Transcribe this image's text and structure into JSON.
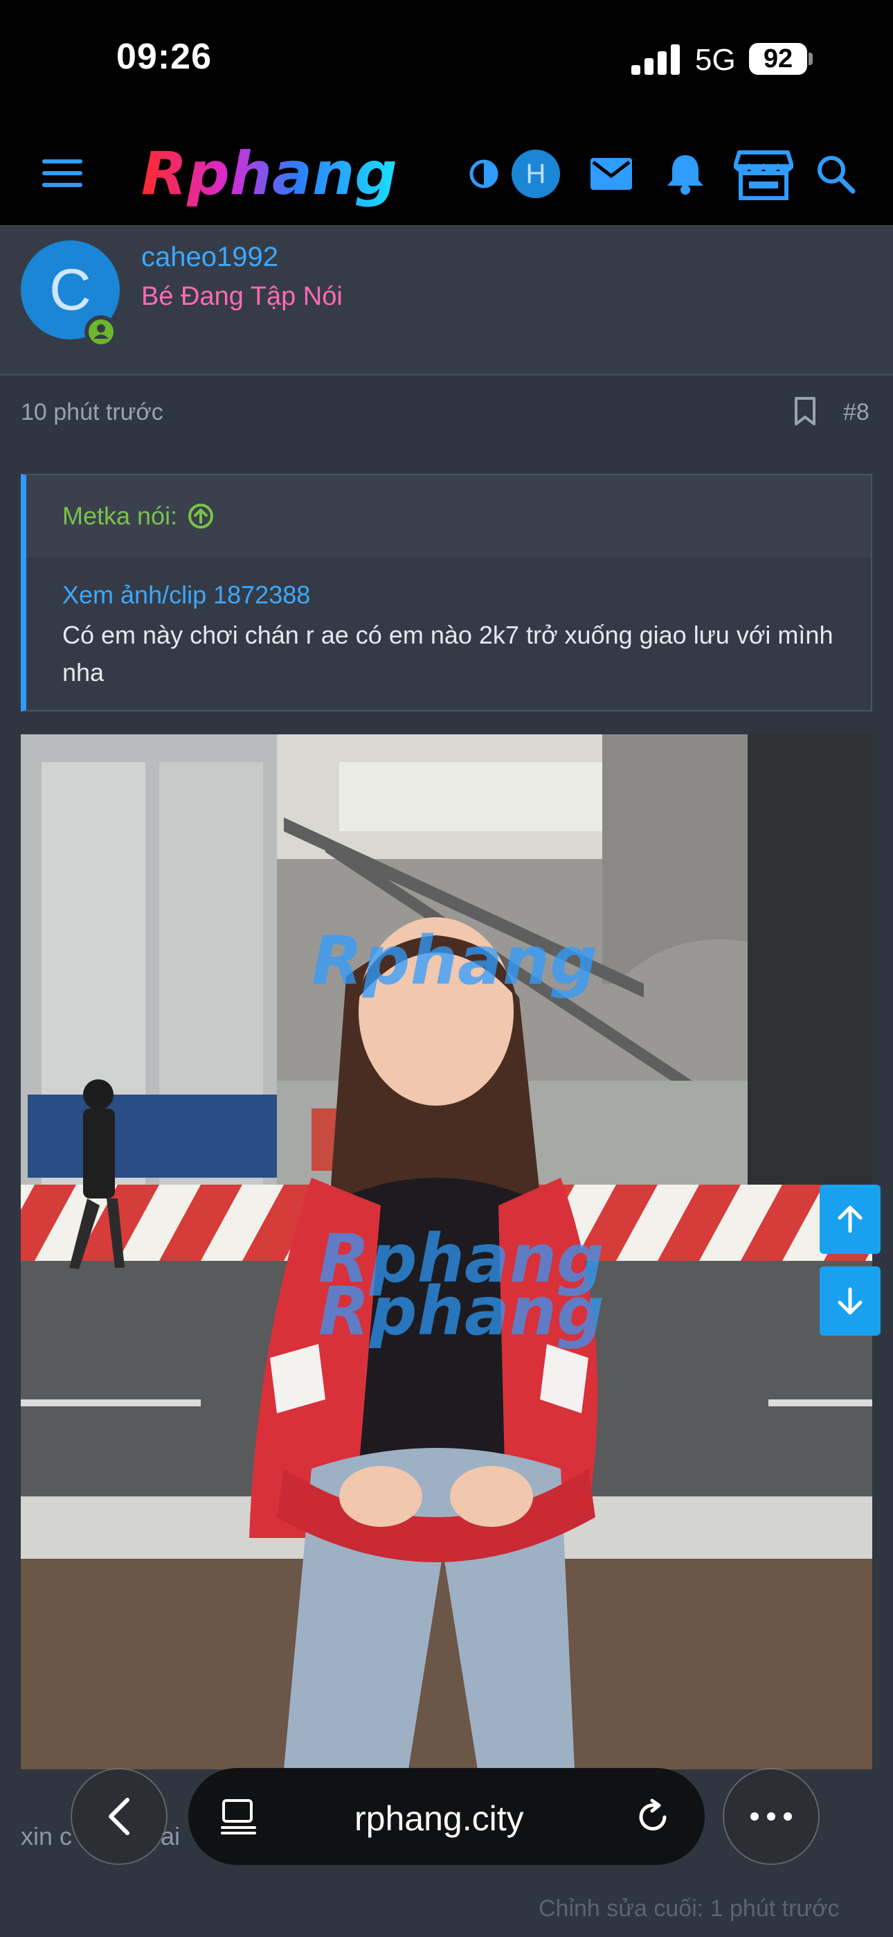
{
  "status_bar": {
    "time": "09:26",
    "network": "5G",
    "battery": "92",
    "signal_level": 4
  },
  "nav": {
    "logo_text": "Rphang",
    "icons": [
      "menu-icon",
      "theme-toggle-icon",
      "mail-icon",
      "bell-icon",
      "store-icon",
      "search-icon"
    ],
    "user_initial": "H"
  },
  "post": {
    "user_initial": "C",
    "username": "caheo1992",
    "user_title": "Bé Đang Tập Nói",
    "time": "10 phút trước",
    "post_number": "#8",
    "quote": {
      "author": "Metka nói:",
      "link": "Xem ảnh/clip 1872388",
      "text": "Có em này chơi chán r ae có em nào 2k7 trở xuống giao lưu với mình nha"
    },
    "image_watermark": "Rphang",
    "reply_text_partial": "xin c",
    "reply_text_partial_2": "ai",
    "edit_note": "Chỉnh sửa cuối: 1 phút trước"
  },
  "browser": {
    "url": "rphang.city"
  },
  "colors": {
    "accent": "#2f9cff",
    "username": "#3ea7ff",
    "user_title": "#ff6ab4",
    "quote_author": "#7cc14b",
    "scroll_button": "#19a1f0"
  }
}
